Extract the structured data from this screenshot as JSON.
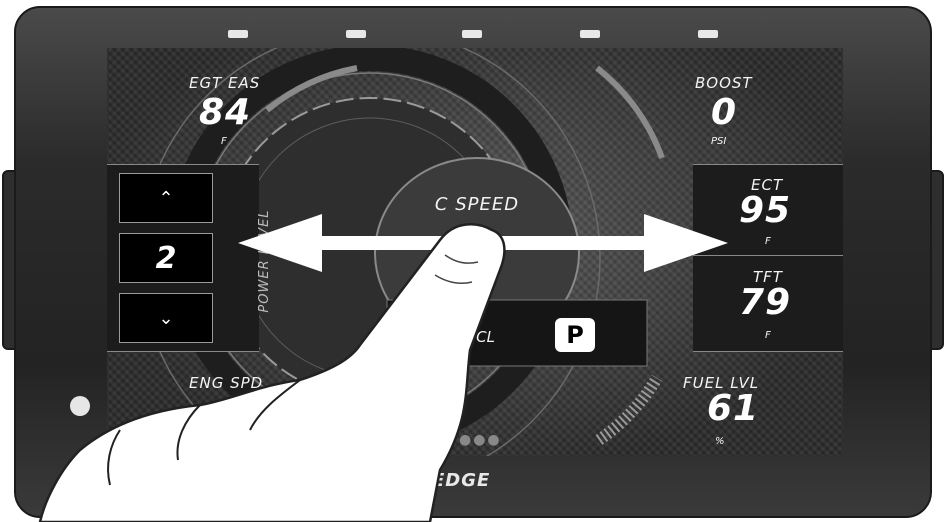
{
  "brand": "EDGE",
  "gauges": {
    "egt": {
      "label": "EGT EAS",
      "value": "84",
      "unit": "F"
    },
    "boost": {
      "label": "BOOST",
      "value": "0",
      "unit": "PSI"
    },
    "ect": {
      "label": "ECT",
      "value": "95",
      "unit": "F"
    },
    "tft": {
      "label": "TFT",
      "value": "79",
      "unit": "F"
    },
    "eng_spd": {
      "label": "ENG SPD"
    },
    "fuel": {
      "label": "FUEL LVL",
      "value": "61",
      "unit": "%"
    }
  },
  "center": {
    "title": "C SPEED",
    "tcl": "TCL",
    "gear": "P"
  },
  "power_level": {
    "label": "POWER LEVEL",
    "value": "2",
    "up_icon": "chevron-up-icon",
    "down_icon": "chevron-down-icon"
  },
  "gesture": {
    "icon": "hand-swipe-icon",
    "arrow": "double-arrow-icon"
  }
}
